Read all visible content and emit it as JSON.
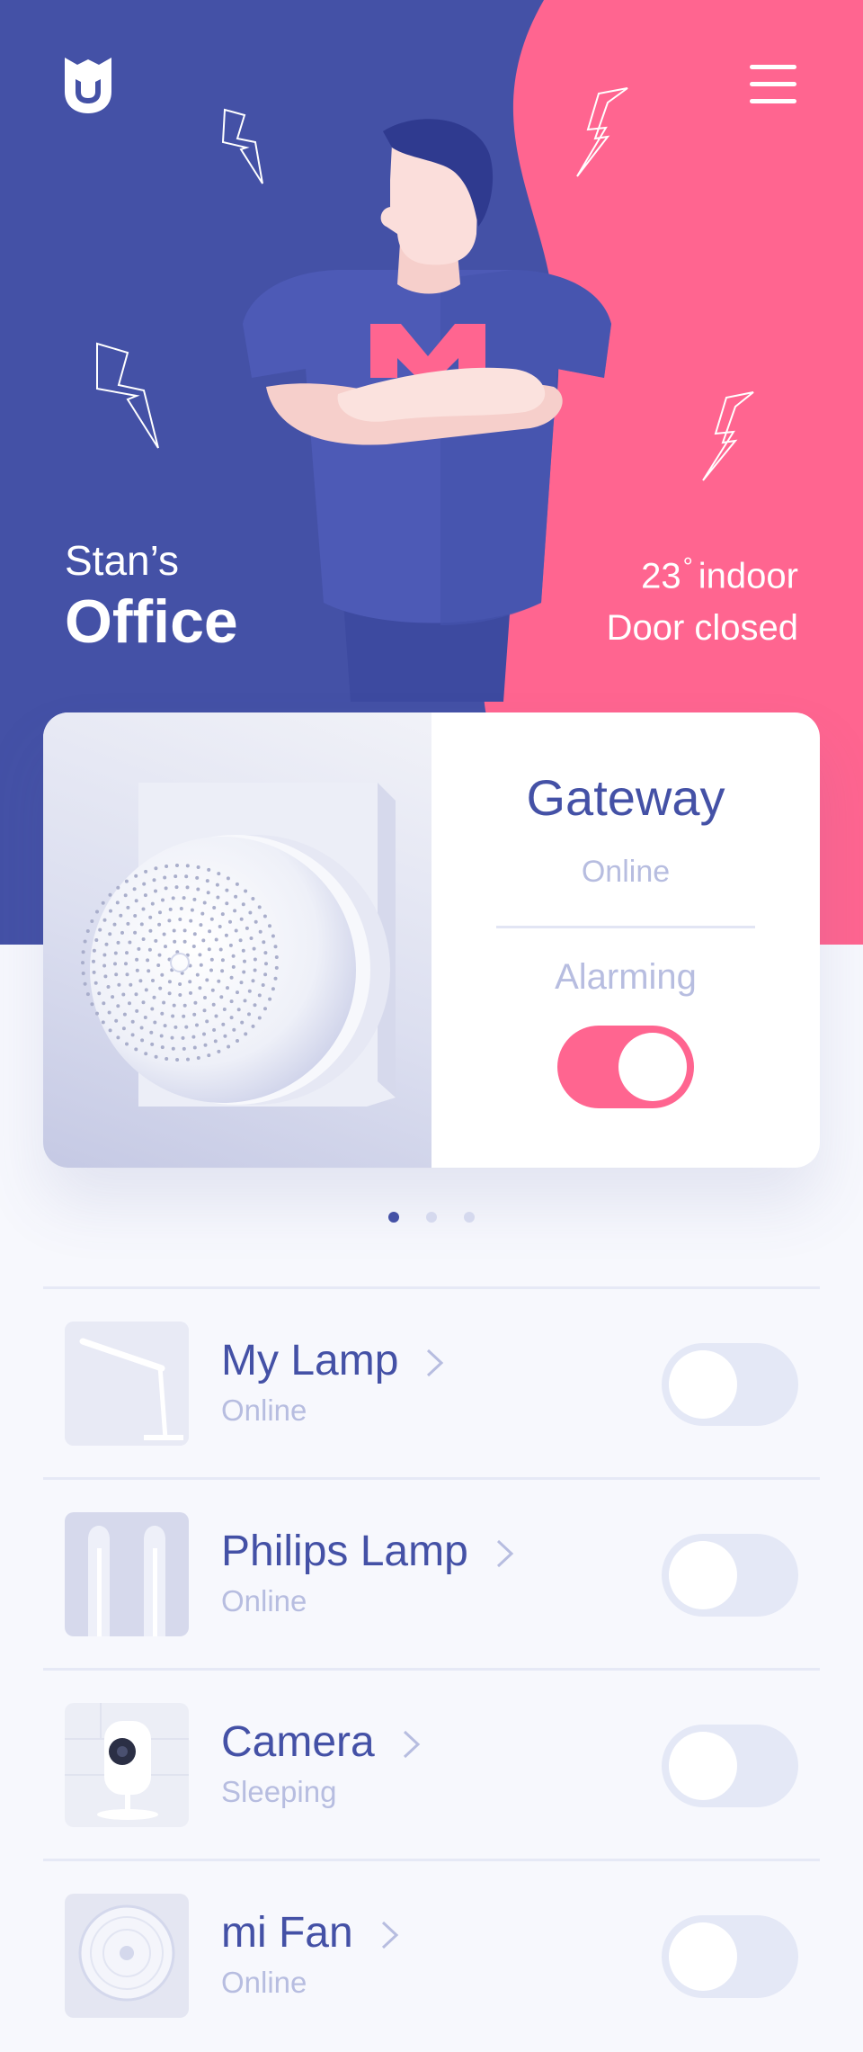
{
  "header": {
    "greeting_sub": "Stan’s",
    "greeting_title": "Office",
    "temperature": "23",
    "temperature_unit": "°",
    "temperature_label": "indoor",
    "door_status": "Door closed"
  },
  "gateway_card": {
    "name": "Gateway",
    "status": "Online",
    "alarm_label": "Alarming",
    "alarm_on": true
  },
  "pagination": {
    "pages": 3,
    "current": 1
  },
  "devices": [
    {
      "name": "My Lamp",
      "status": "Online",
      "on": false,
      "icon": "desk-lamp-icon"
    },
    {
      "name": "Philips Lamp",
      "status": "Online",
      "on": false,
      "icon": "light-tubes-icon"
    },
    {
      "name": "Camera",
      "status": "Sleeping",
      "on": false,
      "icon": "camera-icon"
    },
    {
      "name": "mi Fan",
      "status": "Online",
      "on": false,
      "icon": "fan-icon"
    }
  ],
  "colors": {
    "brand_blue": "#4451a6",
    "brand_pink": "#ff6590",
    "muted_text": "#b7bde0",
    "toggle_off": "#e4e8f6"
  }
}
